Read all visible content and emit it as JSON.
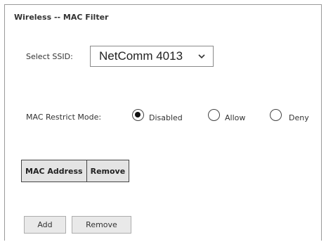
{
  "page": {
    "title": "Wireless -- MAC Filter"
  },
  "ssid": {
    "label": "Select SSID:",
    "selected": "NetComm 4013"
  },
  "mode": {
    "label": "MAC Restrict Mode:",
    "options": [
      {
        "label": "Disabled",
        "checked": true
      },
      {
        "label": "Allow",
        "checked": false
      },
      {
        "label": "Deny",
        "checked": false
      }
    ]
  },
  "table": {
    "columns": [
      "MAC Address",
      "Remove"
    ]
  },
  "buttons": {
    "add_label": "Add",
    "remove_label": "Remove"
  }
}
